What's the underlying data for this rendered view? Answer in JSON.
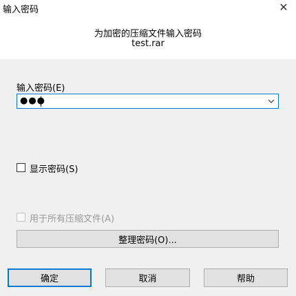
{
  "window": {
    "title": "输入密码",
    "close_symbol": "✕"
  },
  "header": {
    "prompt": "为加密的压缩文件输入密码",
    "filename": "test.rar"
  },
  "password": {
    "label": "输入密码(E)",
    "value": "●●●"
  },
  "show_password": {
    "label": "显示密码(S)",
    "checked": false
  },
  "use_for_all": {
    "label": "用于所有压缩文件(A)",
    "checked": false,
    "enabled": false
  },
  "organize_button": {
    "label": "整理密码(O)..."
  },
  "footer": {
    "ok_label": "确定",
    "cancel_label": "取消",
    "help_label": "帮助"
  },
  "icons": {
    "combo_arrow": "chevron-down-icon",
    "close": "close-icon"
  },
  "colors": {
    "focus_border": "#0078d7",
    "dialog_bg": "#f0f0f0",
    "header_bg": "#ffffff"
  }
}
